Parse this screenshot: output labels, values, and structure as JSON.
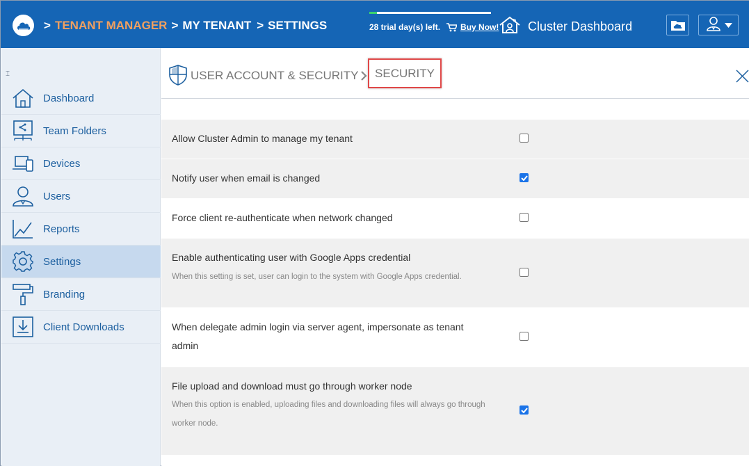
{
  "header": {
    "breadcrumb": [
      {
        "sep": ">",
        "label": "TENANT MANAGER"
      },
      {
        "sep": ">",
        "label": "MY TENANT"
      },
      {
        "sep": ">",
        "label": "SETTINGS"
      }
    ],
    "trial_text": "28 trial day(s) left.",
    "buy_label": "Buy Now!",
    "trial_progress": 0.06,
    "cluster_label": "Cluster Dashboard",
    "colors": {
      "header_bg": "#1565b5",
      "crumb_accent": "#f0a060"
    }
  },
  "sidebar": {
    "collapse_glyph": "⌶",
    "items": [
      {
        "label": "Dashboard",
        "icon": "home-icon",
        "active": false
      },
      {
        "label": "Team Folders",
        "icon": "team-folders-icon",
        "active": false
      },
      {
        "label": "Devices",
        "icon": "devices-icon",
        "active": false
      },
      {
        "label": "Users",
        "icon": "users-icon",
        "active": false
      },
      {
        "label": "Reports",
        "icon": "reports-icon",
        "active": false
      },
      {
        "label": "Settings",
        "icon": "gear-icon",
        "active": true
      },
      {
        "label": "Branding",
        "icon": "paint-roller-icon",
        "active": false
      },
      {
        "label": "Client Downloads",
        "icon": "download-icon",
        "active": false
      }
    ]
  },
  "main": {
    "breadcrumb_parent": "USER ACCOUNT & SECURITY",
    "breadcrumb_current": "SECURITY",
    "settings": [
      {
        "label": "Allow Cluster Admin to manage my tenant",
        "description": "",
        "checked": false
      },
      {
        "label": "Notify user when email is changed",
        "description": "",
        "checked": true
      },
      {
        "label": "Force client re-authenticate when network changed",
        "description": "",
        "checked": false
      },
      {
        "label": "Enable authenticating user with Google Apps credential",
        "description": "When this setting is set, user can login to the system with Google Apps credential.",
        "checked": false
      },
      {
        "label": "When delegate admin login via server agent, impersonate as tenant admin",
        "description": "",
        "checked": false
      },
      {
        "label": "File upload and download must go through worker node",
        "description": "When this option is enabled, uploading files and downloading files will always go through worker node.",
        "checked": true
      }
    ]
  }
}
